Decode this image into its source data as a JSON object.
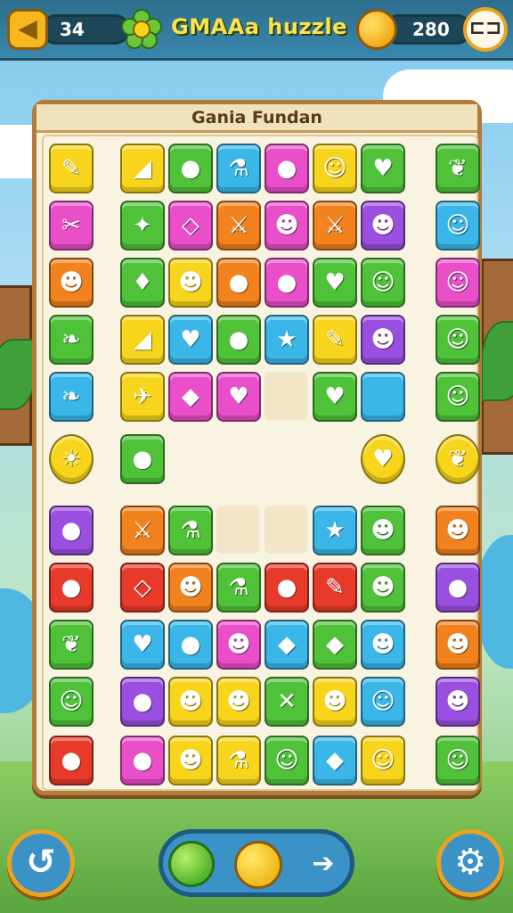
{
  "header": {
    "back_icon": "arrow-left-icon",
    "moves": "34",
    "flower_icon": "flower-icon",
    "title": "GMAAa huzzle",
    "coin_icon": "coin-icon",
    "score": "280",
    "menu_icon": "menu-icon",
    "menu_glyph": "⊏⊐"
  },
  "board": {
    "title": "Gania Fundan",
    "tile_colors": {
      "yellow": "#f7d51c",
      "green": "#4fc23a",
      "pink": "#e84fc8",
      "blue": "#3ab7e8",
      "orange": "#f2821e",
      "purple": "#9a4fe0",
      "red": "#e83a2a"
    },
    "tiles": [
      {
        "r": 0,
        "c": 0,
        "color": "yellow",
        "icon": "crayon-icon",
        "glyph": "✎"
      },
      {
        "r": 0,
        "c": 2,
        "color": "yellow",
        "icon": "banana-icon",
        "glyph": "◢"
      },
      {
        "r": 0,
        "c": 3,
        "color": "green",
        "icon": "plum-icon",
        "glyph": "●"
      },
      {
        "r": 0,
        "c": 4,
        "color": "blue",
        "icon": "potion-icon",
        "glyph": "⚗"
      },
      {
        "r": 0,
        "c": 5,
        "color": "pink",
        "icon": "lime-icon",
        "glyph": "●"
      },
      {
        "r": 0,
        "c": 6,
        "color": "yellow",
        "icon": "lemon-face-icon",
        "glyph": "☺"
      },
      {
        "r": 0,
        "c": 7,
        "color": "green",
        "icon": "heart-icon",
        "glyph": "♥"
      },
      {
        "r": 0,
        "c": 8,
        "color": "green",
        "icon": "leaf-icon",
        "glyph": "❦"
      },
      {
        "r": 1,
        "c": 0,
        "color": "pink",
        "icon": "scissors-icon",
        "glyph": "✂"
      },
      {
        "r": 1,
        "c": 2,
        "color": "green",
        "icon": "star-icon",
        "glyph": "✦"
      },
      {
        "r": 1,
        "c": 3,
        "color": "pink",
        "icon": "tag-icon",
        "glyph": "◇"
      },
      {
        "r": 1,
        "c": 4,
        "color": "orange",
        "icon": "sword-icon",
        "glyph": "⚔"
      },
      {
        "r": 1,
        "c": 5,
        "color": "pink",
        "icon": "chick-icon",
        "glyph": "☻"
      },
      {
        "r": 1,
        "c": 6,
        "color": "orange",
        "icon": "sword-icon",
        "glyph": "⚔"
      },
      {
        "r": 1,
        "c": 7,
        "color": "purple",
        "icon": "cat-face-icon",
        "glyph": "☻"
      },
      {
        "r": 1,
        "c": 8,
        "color": "blue",
        "icon": "dog-face-icon",
        "glyph": "☺"
      },
      {
        "r": 2,
        "c": 0,
        "color": "orange",
        "icon": "bear-face-icon",
        "glyph": "☻"
      },
      {
        "r": 2,
        "c": 2,
        "color": "green",
        "icon": "strawberry-icon",
        "glyph": "♦"
      },
      {
        "r": 2,
        "c": 3,
        "color": "yellow",
        "icon": "orange-face-icon",
        "glyph": "☻"
      },
      {
        "r": 2,
        "c": 4,
        "color": "orange",
        "icon": "bird-icon",
        "glyph": "●"
      },
      {
        "r": 2,
        "c": 5,
        "color": "pink",
        "icon": "drop-icon",
        "glyph": "●"
      },
      {
        "r": 2,
        "c": 6,
        "color": "green",
        "icon": "heart-icon",
        "glyph": "♥"
      },
      {
        "r": 2,
        "c": 7,
        "color": "green",
        "icon": "frog-face-icon",
        "glyph": "☺"
      },
      {
        "r": 2,
        "c": 8,
        "color": "pink",
        "icon": "cactus-face-icon",
        "glyph": "☺"
      },
      {
        "r": 3,
        "c": 0,
        "color": "green",
        "icon": "cucumber-icon",
        "glyph": "❧"
      },
      {
        "r": 3,
        "c": 2,
        "color": "yellow",
        "icon": "banana-icon",
        "glyph": "◢"
      },
      {
        "r": 3,
        "c": 3,
        "color": "blue",
        "icon": "heart-icon",
        "glyph": "♥"
      },
      {
        "r": 3,
        "c": 4,
        "color": "green",
        "icon": "tomato-icon",
        "glyph": "●"
      },
      {
        "r": 3,
        "c": 5,
        "color": "blue",
        "icon": "star-face-icon",
        "glyph": "★"
      },
      {
        "r": 3,
        "c": 6,
        "color": "yellow",
        "icon": "pencil-icon",
        "glyph": "✎"
      },
      {
        "r": 3,
        "c": 7,
        "color": "purple",
        "icon": "monster-face-icon",
        "glyph": "☻"
      },
      {
        "r": 3,
        "c": 8,
        "color": "green",
        "icon": "orange-face-icon",
        "glyph": "☺"
      },
      {
        "r": 4,
        "c": 0,
        "color": "blue",
        "icon": "corn-icon",
        "glyph": "❧"
      },
      {
        "r": 4,
        "c": 2,
        "color": "yellow",
        "icon": "rocket-icon",
        "glyph": "✈"
      },
      {
        "r": 4,
        "c": 3,
        "color": "pink",
        "icon": "feather-icon",
        "glyph": "◆"
      },
      {
        "r": 4,
        "c": 4,
        "color": "pink",
        "icon": "heart-icon",
        "glyph": "♥"
      },
      {
        "r": 4,
        "c": 6,
        "color": "green",
        "icon": "heart-icon",
        "glyph": "♥"
      },
      {
        "r": 4,
        "c": 7,
        "color": "blue",
        "icon": "blank-tile-icon",
        "glyph": ""
      },
      {
        "r": 4,
        "c": 8,
        "color": "green",
        "icon": "chick-face-icon",
        "glyph": "☺"
      },
      {
        "r": 6,
        "c": 0,
        "color": "purple",
        "icon": "grape-icon",
        "glyph": "●"
      },
      {
        "r": 6,
        "c": 2,
        "color": "orange",
        "icon": "sword-icon",
        "glyph": "⚔"
      },
      {
        "r": 6,
        "c": 3,
        "color": "green",
        "icon": "potion-icon",
        "glyph": "⚗"
      },
      {
        "r": 6,
        "c": 6,
        "color": "blue",
        "icon": "star-face-icon",
        "glyph": "★"
      },
      {
        "r": 6,
        "c": 7,
        "color": "green",
        "icon": "fox-face-icon",
        "glyph": "☻"
      },
      {
        "r": 6,
        "c": 8,
        "color": "orange",
        "icon": "fox-face-icon",
        "glyph": "☻"
      },
      {
        "r": 7,
        "c": 0,
        "color": "red",
        "icon": "pepper-icon",
        "glyph": "●"
      },
      {
        "r": 7,
        "c": 2,
        "color": "red",
        "icon": "tag-icon",
        "glyph": "◇"
      },
      {
        "r": 7,
        "c": 3,
        "color": "orange",
        "icon": "cat-face-icon",
        "glyph": "☻"
      },
      {
        "r": 7,
        "c": 4,
        "color": "green",
        "icon": "potion-icon",
        "glyph": "⚗"
      },
      {
        "r": 7,
        "c": 5,
        "color": "red",
        "icon": "lime-icon",
        "glyph": "●"
      },
      {
        "r": 7,
        "c": 6,
        "color": "red",
        "icon": "crayon-icon",
        "glyph": "✎"
      },
      {
        "r": 7,
        "c": 7,
        "color": "green",
        "icon": "fox-face-icon",
        "glyph": "☻"
      },
      {
        "r": 7,
        "c": 8,
        "color": "purple",
        "icon": "balloon-icon",
        "glyph": "●"
      },
      {
        "r": 8,
        "c": 0,
        "color": "green",
        "icon": "pea-pod-icon",
        "glyph": "❦"
      },
      {
        "r": 8,
        "c": 2,
        "color": "blue",
        "icon": "heart-icon",
        "glyph": "♥"
      },
      {
        "r": 8,
        "c": 3,
        "color": "blue",
        "icon": "pear-icon",
        "glyph": "●"
      },
      {
        "r": 8,
        "c": 4,
        "color": "pink",
        "icon": "pig-face-icon",
        "glyph": "☻"
      },
      {
        "r": 8,
        "c": 5,
        "color": "blue",
        "icon": "carrot-icon",
        "glyph": "◆"
      },
      {
        "r": 8,
        "c": 6,
        "color": "green",
        "icon": "pineapple-icon",
        "glyph": "◆"
      },
      {
        "r": 8,
        "c": 7,
        "color": "blue",
        "icon": "cat-face-icon",
        "glyph": "☻"
      },
      {
        "r": 8,
        "c": 8,
        "color": "orange",
        "icon": "fox-face-icon",
        "glyph": "☻"
      },
      {
        "r": 9,
        "c": 0,
        "color": "green",
        "icon": "frog-face-icon",
        "glyph": "☺"
      },
      {
        "r": 9,
        "c": 2,
        "color": "purple",
        "icon": "balloon-icon",
        "glyph": "●"
      },
      {
        "r": 9,
        "c": 3,
        "color": "yellow",
        "icon": "fox-face-icon",
        "glyph": "☻"
      },
      {
        "r": 9,
        "c": 4,
        "color": "yellow",
        "icon": "monster-face-icon",
        "glyph": "☻"
      },
      {
        "r": 9,
        "c": 5,
        "color": "green",
        "icon": "bone-icon",
        "glyph": "✕"
      },
      {
        "r": 9,
        "c": 6,
        "color": "yellow",
        "icon": "cat-face-icon",
        "glyph": "☻"
      },
      {
        "r": 9,
        "c": 7,
        "color": "blue",
        "icon": "dog-face-icon",
        "glyph": "☺"
      },
      {
        "r": 9,
        "c": 8,
        "color": "purple",
        "icon": "cat-face-icon",
        "glyph": "☻"
      },
      {
        "r": 10,
        "c": 0,
        "color": "red",
        "icon": "pepper-icon",
        "glyph": "●"
      },
      {
        "r": 10,
        "c": 2,
        "color": "pink",
        "icon": "apple-icon",
        "glyph": "●"
      },
      {
        "r": 10,
        "c": 3,
        "color": "yellow",
        "icon": "cat-face-icon",
        "glyph": "☻"
      },
      {
        "r": 10,
        "c": 4,
        "color": "yellow",
        "icon": "potion-icon",
        "glyph": "⚗"
      },
      {
        "r": 10,
        "c": 5,
        "color": "green",
        "icon": "monster-face-icon",
        "glyph": "☺"
      },
      {
        "r": 10,
        "c": 6,
        "color": "blue",
        "icon": "pineapple-icon",
        "glyph": "◆"
      },
      {
        "r": 10,
        "c": 7,
        "color": "yellow",
        "icon": "orange-face-icon",
        "glyph": "☺"
      },
      {
        "r": 10,
        "c": 8,
        "color": "green",
        "icon": "frog-face-icon",
        "glyph": "☺"
      }
    ],
    "loose_items": [
      {
        "r": 5,
        "c": 0,
        "color": "yellow",
        "icon": "sun-face-icon",
        "glyph": "☀",
        "shape": "round"
      },
      {
        "r": 5,
        "c": 2,
        "color": "green",
        "icon": "apple-icon",
        "glyph": "●",
        "shape": "square"
      },
      {
        "r": 5,
        "c": 7,
        "color": "yellow",
        "icon": "heart-icon",
        "glyph": "♥",
        "shape": "round"
      },
      {
        "r": 5,
        "c": 8,
        "color": "yellow",
        "icon": "leaf-icon",
        "glyph": "❦",
        "shape": "round"
      }
    ],
    "empty_slots": [
      {
        "r": 4,
        "c": 5
      },
      {
        "r": 6,
        "c": 4
      },
      {
        "r": 6,
        "c": 5
      }
    ]
  },
  "footer": {
    "refresh_icon": "refresh-icon",
    "refresh_glyph": "↺",
    "settings_icon": "gear-icon",
    "settings_glyph": "⚙",
    "tray_items": [
      "apple-icon",
      "orb-icon",
      "arrow-right-icon"
    ],
    "arrow_glyph": "➔"
  }
}
